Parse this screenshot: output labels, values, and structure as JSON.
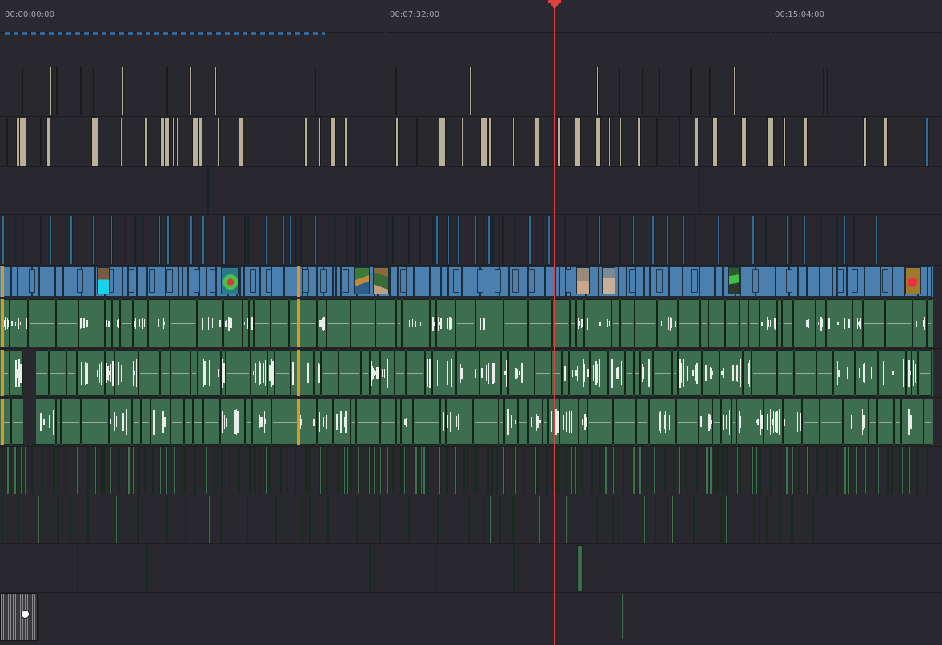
{
  "timeline": {
    "ruler": {
      "timecodes": [
        "00:00:00:00",
        "00:07:32:00",
        "00:15:04:00"
      ]
    },
    "tracks": [
      {
        "id": "track-1",
        "kind": "empty"
      },
      {
        "id": "track-2",
        "kind": "video-beige"
      },
      {
        "id": "track-3",
        "kind": "video-beige"
      },
      {
        "id": "track-4",
        "kind": "video-thin"
      },
      {
        "id": "track-5",
        "kind": "video-blue-thin"
      },
      {
        "id": "track-6",
        "kind": "video-main"
      },
      {
        "id": "track-7",
        "kind": "audio-main"
      },
      {
        "id": "track-8",
        "kind": "audio"
      },
      {
        "id": "track-9",
        "kind": "audio"
      },
      {
        "id": "track-10",
        "kind": "audio-thin"
      },
      {
        "id": "track-11",
        "kind": "audio-thin"
      },
      {
        "id": "track-12",
        "kind": "audio-sparse"
      },
      {
        "id": "track-13",
        "kind": "title"
      }
    ],
    "colors": {
      "background": "#28282e",
      "beige_clip": "#b9b09a",
      "video_clip": "#4a7fae",
      "audio_clip": "#3d6e4f",
      "playhead": "#e04040",
      "marker": "#d89b22"
    }
  }
}
